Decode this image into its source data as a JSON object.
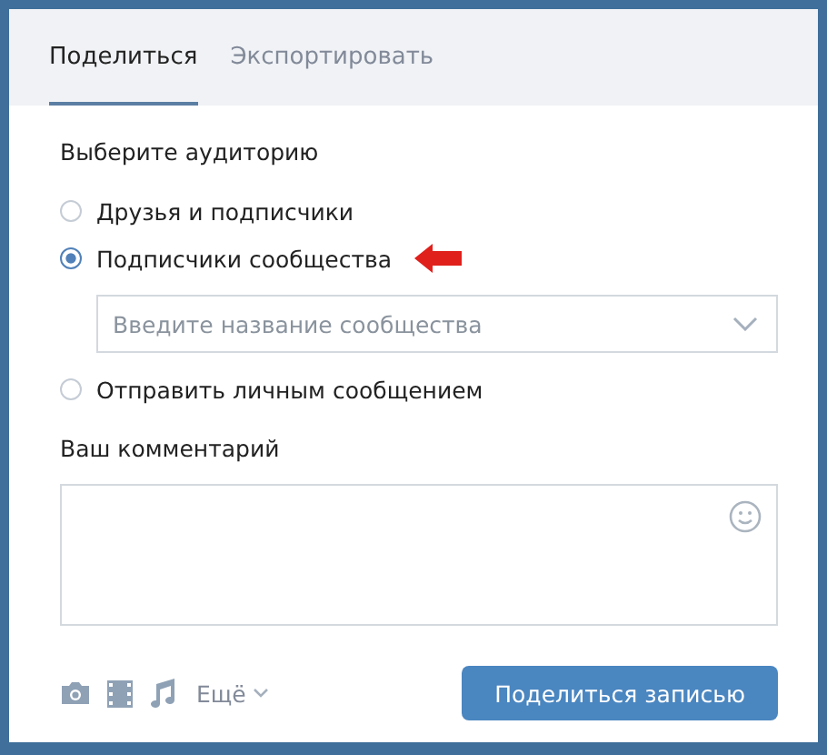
{
  "tabs": [
    {
      "label": "Поделиться",
      "selected": true
    },
    {
      "label": "Экспортировать",
      "selected": false
    }
  ],
  "audience": {
    "title": "Выберите аудиторию",
    "options": [
      {
        "label": "Друзья и подписчики",
        "selected": false
      },
      {
        "label": "Подписчики сообщества",
        "selected": true,
        "select": {
          "placeholder": "Введите название сообщества"
        }
      },
      {
        "label": "Отправить личным сообщением",
        "selected": false
      }
    ]
  },
  "comment": {
    "title": "Ваш комментарий"
  },
  "toolbar": {
    "more": "Ещё",
    "submit": "Поделиться записью"
  }
}
